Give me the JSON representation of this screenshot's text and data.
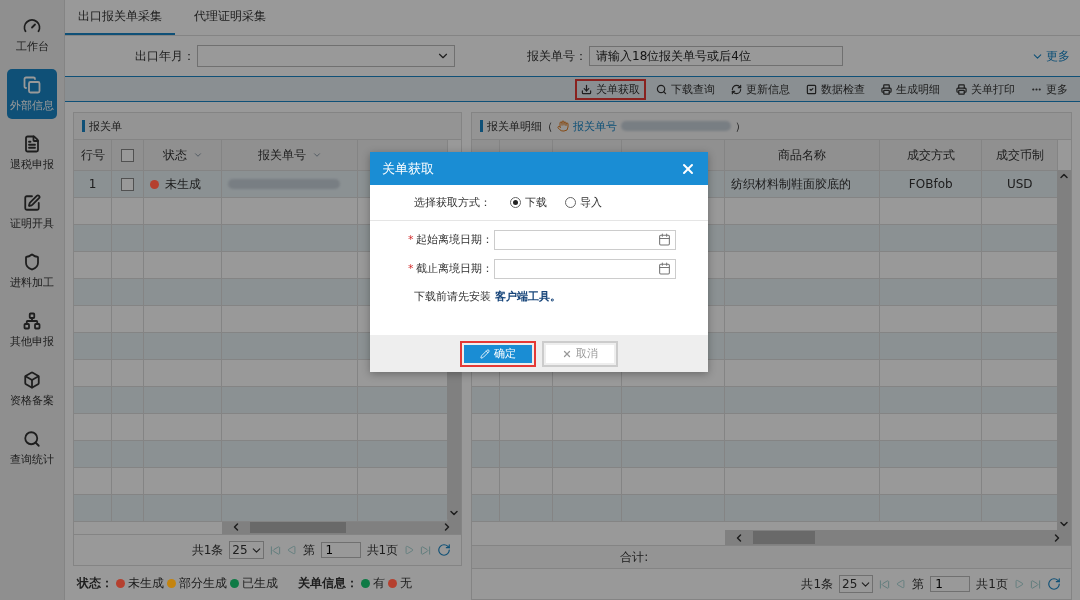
{
  "sidebar": {
    "items": [
      {
        "label": "工作台",
        "selected": false
      },
      {
        "label": "外部信息",
        "selected": true
      },
      {
        "label": "退税申报",
        "selected": false
      },
      {
        "label": "证明开具",
        "selected": false
      },
      {
        "label": "进料加工",
        "selected": false
      },
      {
        "label": "其他申报",
        "selected": false
      },
      {
        "label": "资格备案",
        "selected": false
      },
      {
        "label": "查询统计",
        "selected": false
      }
    ]
  },
  "tabs": [
    {
      "label": "出口报关单采集",
      "selected": true
    },
    {
      "label": "代理证明采集",
      "selected": false
    }
  ],
  "filters": {
    "month_label": "出口年月：",
    "number_label": "报关单号：",
    "number_placeholder": "请输入18位报关单号或后4位",
    "more": "更多"
  },
  "toolbar": [
    {
      "label": "关单获取",
      "highlighted": true
    },
    {
      "label": "下载查询",
      "highlighted": false
    },
    {
      "label": "更新信息",
      "highlighted": false
    },
    {
      "label": "数据检查",
      "highlighted": false
    },
    {
      "label": "生成明细",
      "highlighted": false
    },
    {
      "label": "关单打印",
      "highlighted": false
    },
    {
      "label": "更多",
      "highlighted": false
    }
  ],
  "left_panel": {
    "title": "报关单",
    "header": {
      "row_no": "行号",
      "checked": false,
      "status": "状态",
      "number": "报关单号"
    },
    "rows": [
      {
        "row_no": "1",
        "checked": false,
        "status": "未生成",
        "color": "#b5402f"
      }
    ],
    "pager": {
      "total": "共1条",
      "page_size": "25",
      "page_label": "第",
      "page": "1",
      "pages": "共1页"
    }
  },
  "legend": {
    "status_label": "状态：",
    "statuses": [
      {
        "label": "未生成",
        "color": "#b5402f"
      },
      {
        "label": "部分生成",
        "color": "#c4840f"
      },
      {
        "label": "已生成",
        "color": "#0e7a45"
      }
    ],
    "info_label": "关单信息：",
    "infos": [
      {
        "label": "有",
        "color": "#0e7a45"
      },
      {
        "label": "无",
        "color": "#b5402f"
      }
    ]
  },
  "right_panel": {
    "title": "报关单明细（",
    "link": "报关单号",
    "close_paren": "）",
    "header": {
      "name": "商品名称",
      "deal": "成交方式",
      "currency": "成交币制"
    },
    "rows": [
      {
        "name": "纺织材料制鞋面胶底的",
        "deal": "FOBfob",
        "currency": "USD"
      }
    ],
    "total_label": "合计:",
    "pager": {
      "total": "共1条",
      "page_size": "25",
      "page_label": "第",
      "page": "1",
      "pages": "共1页"
    }
  },
  "dialog": {
    "title": "关单获取",
    "method_label": "选择获取方式：",
    "options": [
      {
        "label": "下载",
        "selected": true
      },
      {
        "label": "导入",
        "selected": false
      }
    ],
    "required_mark": "*",
    "dates": [
      {
        "label": "起始离境日期：",
        "required": true
      },
      {
        "label": "截止离境日期：",
        "required": true
      }
    ],
    "note": "下载前请先安装",
    "note_link": "客户端工具。",
    "buttons": [
      {
        "label": "确定",
        "kind": "primary",
        "highlighted": true
      },
      {
        "label": "取消",
        "kind": "secondary",
        "highlighted": false
      }
    ]
  }
}
